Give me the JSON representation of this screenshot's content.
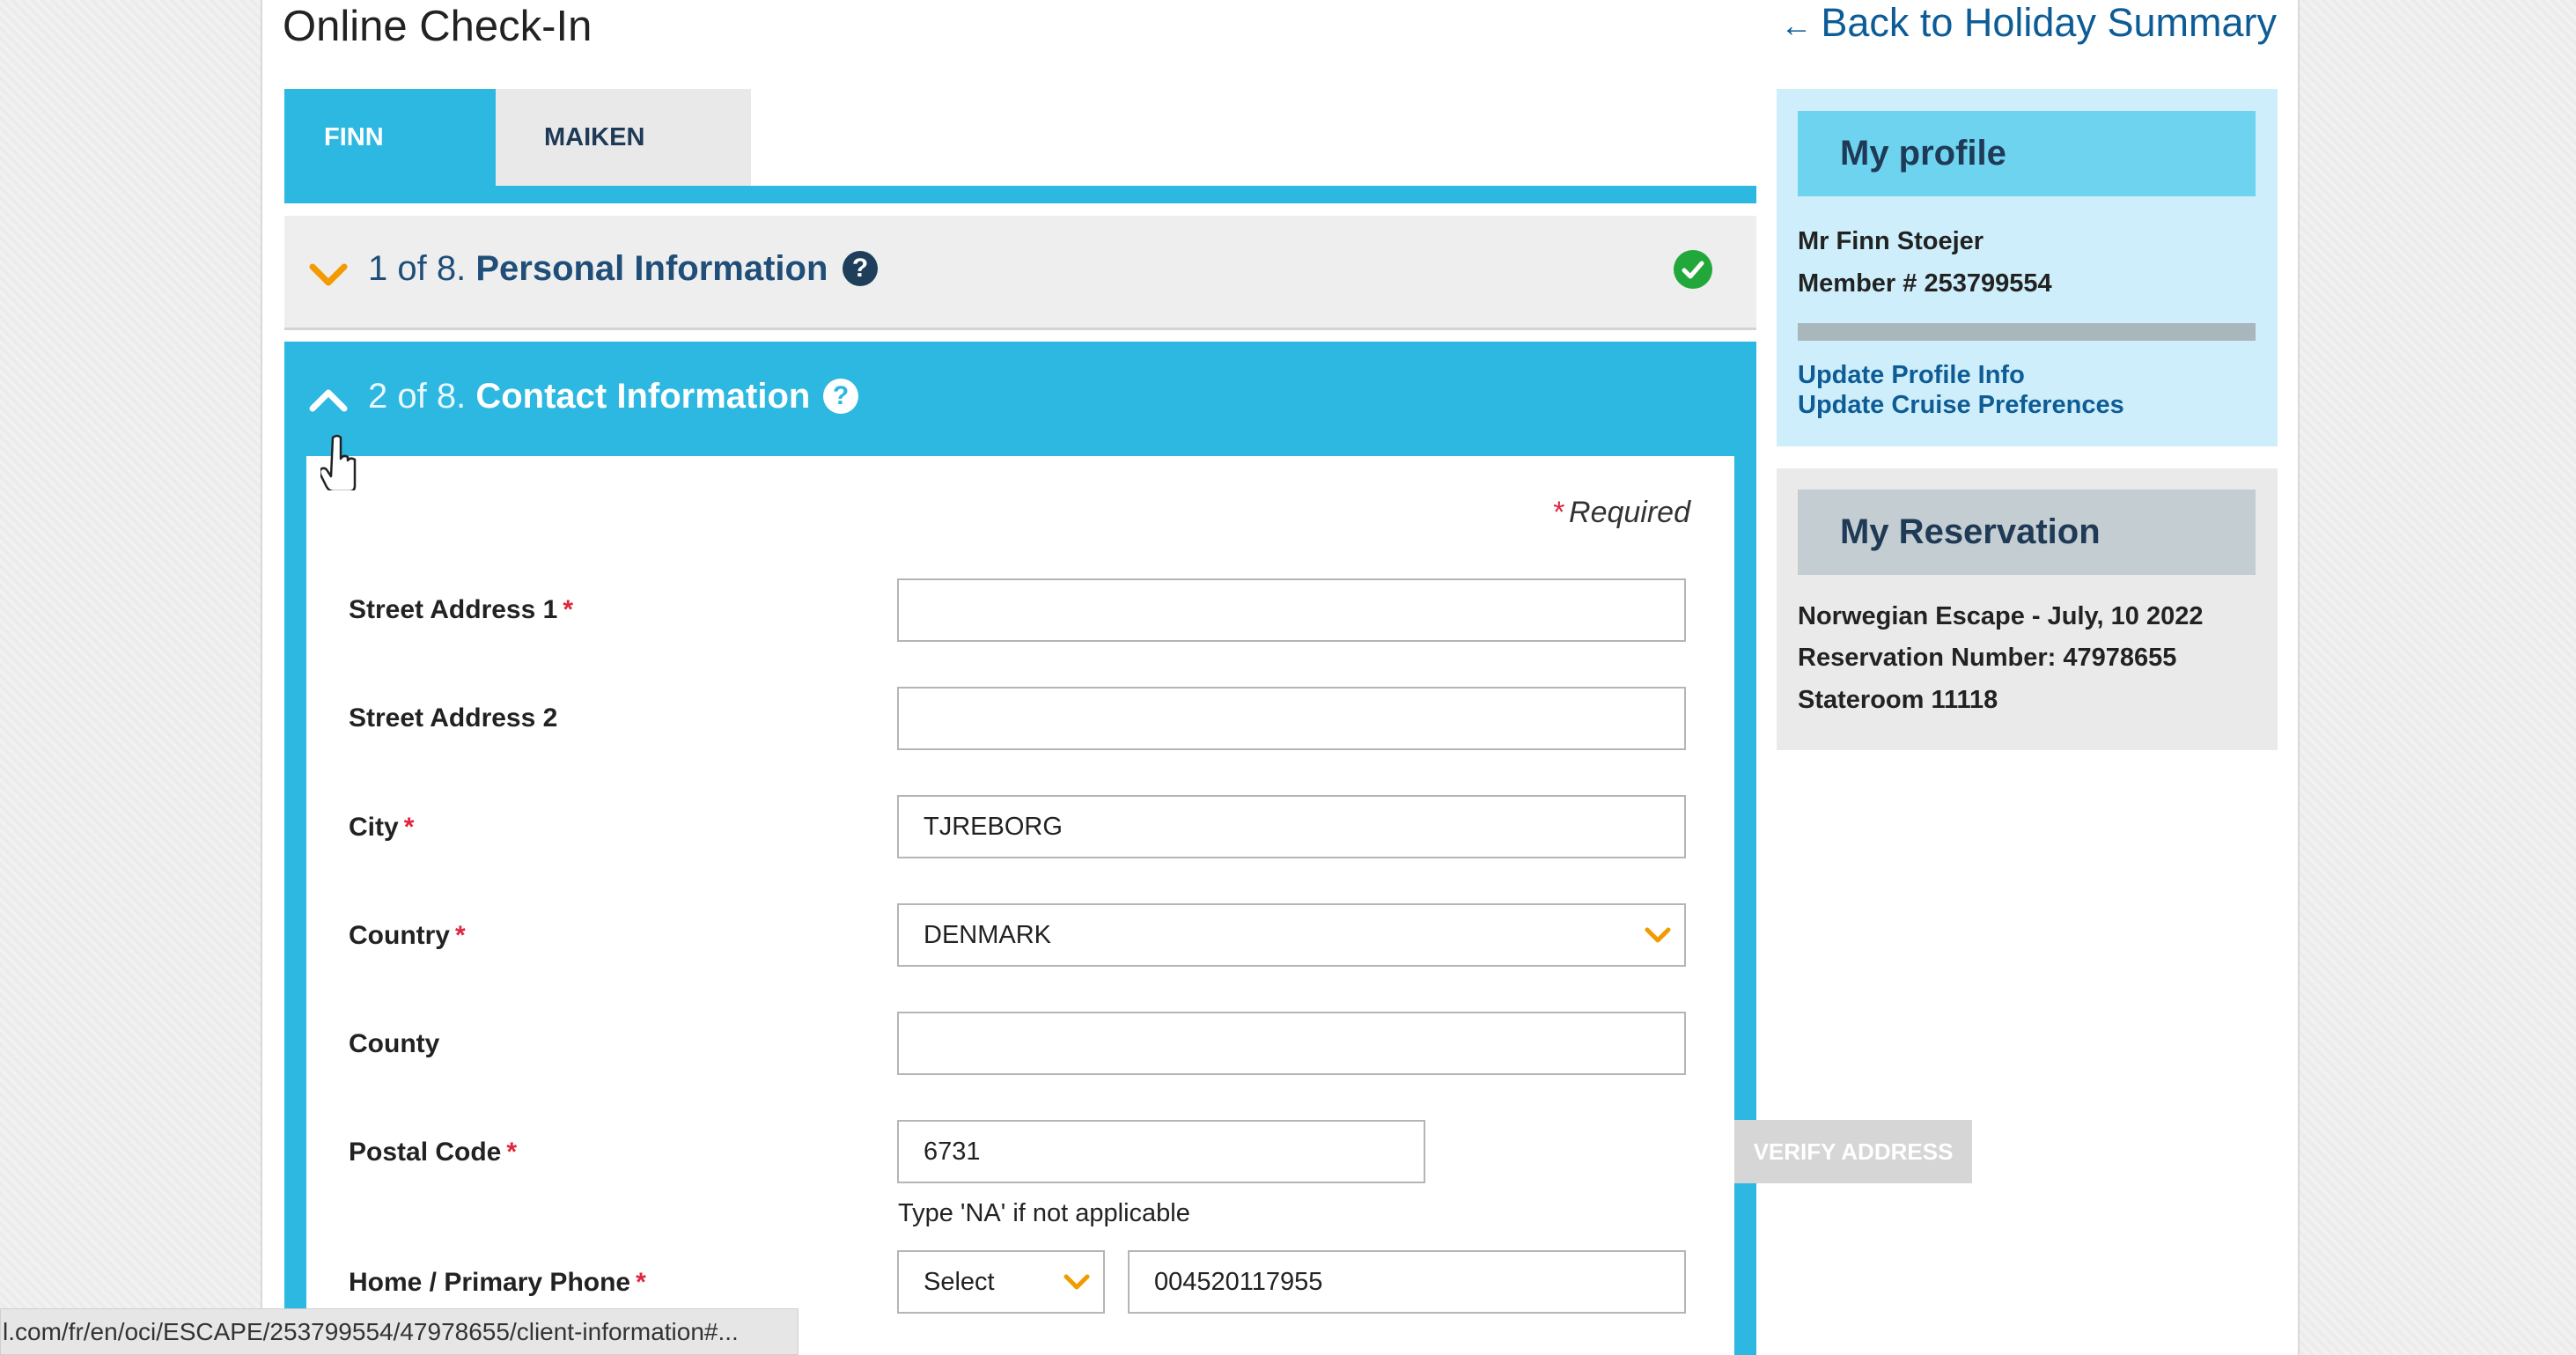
{
  "page": {
    "title": "Online Check-In",
    "back_link": "Back to Holiday Summary",
    "back_arrow": "←"
  },
  "tabs": [
    {
      "label": "FINN",
      "active": true
    },
    {
      "label": "MAIKEN",
      "active": false
    }
  ],
  "sections": [
    {
      "step": "1 of 8.",
      "title": "Personal Information",
      "help": "?",
      "status": "complete",
      "expanded": false
    },
    {
      "step": "2 of 8.",
      "title": "Contact Information",
      "help": "?",
      "expanded": true
    }
  ],
  "form": {
    "required_note": "Required",
    "required_mark": "*",
    "fields": [
      {
        "label": "Street Address 1",
        "required": true,
        "value": ""
      },
      {
        "label": "Street Address 2",
        "required": false,
        "value": ""
      },
      {
        "label": "City",
        "required": true,
        "value": "TJREBORG"
      },
      {
        "label": "Country",
        "required": true,
        "value": "DENMARK"
      },
      {
        "label": "County",
        "required": false,
        "value": ""
      },
      {
        "label": "Postal Code",
        "required": true,
        "value": "6731"
      },
      {
        "label": "Home / Primary Phone",
        "required": true,
        "value": "004520117955",
        "code": "Select"
      }
    ],
    "verify_button": "VERIFY ADDRESS",
    "postal_hint": "Type 'NA' if not applicable"
  },
  "profile": {
    "heading": "My profile",
    "name": "Mr Finn Stoejer",
    "member": "Member # 253799554",
    "links": [
      "Update Profile Info",
      "Update Cruise Preferences"
    ]
  },
  "reservation": {
    "heading": "My Reservation",
    "cruise": "Norwegian Escape - July, 10 2022",
    "number": "Reservation Number: 47978655",
    "stateroom": "Stateroom 11118"
  },
  "status_bar": {
    "url": "l.com/fr/en/oci/ESCAPE/253799554/47978655/client-information#..."
  },
  "colors": {
    "accent": "#2cb8e1",
    "chevron": "#f39a00",
    "check": "#22a83a",
    "required": "#e0263c",
    "link": "#0e5c96"
  },
  "icons": {
    "collapsed": "chevron-down-icon",
    "expanded": "chevron-up-icon",
    "complete": "check-circle-icon",
    "help": "help-icon",
    "dropdown": "chevron-down-icon"
  }
}
